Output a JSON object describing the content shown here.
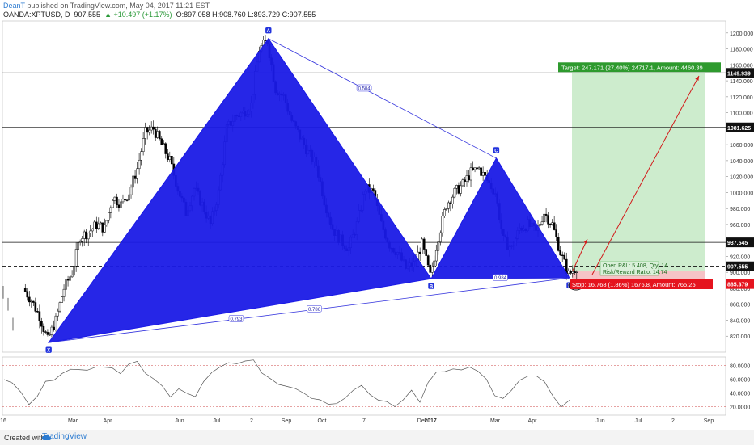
{
  "header": {
    "author": "DeanT",
    "published": " published on TradingView.com, May 04, 2017 11:21 EST",
    "symbol": "OANDA:XPTUSD, D",
    "last": "907.555",
    "change": "▲ +10.497 (+1.17%)",
    "ohlc": "O:897.058 H:908.760 L:893.729 C:907.555"
  },
  "footer": {
    "made_with": "Created with",
    "brand": "TradingView"
  },
  "colors": {
    "pattern_fill": "#1a1ae6",
    "target_zone": "#cdeccd",
    "stop_zone": "#f6c3c6",
    "target_label": "#2e9a2e",
    "stop_label": "#e5141e",
    "arrow": "#d21a1a",
    "rsi_line": "#555555"
  },
  "chart_data": {
    "type": "candlestick",
    "symbol": "XPTUSD",
    "timeframe": "D",
    "ylim": [
      800,
      1215
    ],
    "y_ticks": [
      "1200.000",
      "1180.000",
      "1160.000",
      "1140.000",
      "1120.000",
      "1100.000",
      "1080.000",
      "1060.000",
      "1040.000",
      "1020.000",
      "1000.000",
      "980.000",
      "960.000",
      "940.000",
      "920.000",
      "900.000",
      "880.000",
      "860.000",
      "840.000",
      "820.000",
      "800.000"
    ],
    "x_labels": [
      "16",
      "Mar",
      "Apr",
      "Jun",
      "Jul",
      "2",
      "Sep",
      "Oct",
      "7",
      "Dec",
      "2017",
      "Mar",
      "Apr",
      "Jun",
      "Jul",
      "2",
      "Sep"
    ],
    "price_path": [
      [
        0,
        880
      ],
      [
        1,
        865
      ],
      [
        2,
        845
      ],
      [
        3,
        815
      ],
      [
        4,
        840
      ],
      [
        5,
        880
      ],
      [
        6,
        900
      ],
      [
        7,
        945
      ],
      [
        8,
        950
      ],
      [
        9,
        960
      ],
      [
        10,
        955
      ],
      [
        11,
        995
      ],
      [
        12,
        985
      ],
      [
        13,
        1000
      ],
      [
        14,
        1030
      ],
      [
        15,
        1075
      ],
      [
        16,
        1080
      ],
      [
        17,
        1060
      ],
      [
        18,
        1040
      ],
      [
        19,
        1005
      ],
      [
        20,
        975
      ],
      [
        21,
        1005
      ],
      [
        22,
        985
      ],
      [
        23,
        960
      ],
      [
        24,
        1000
      ],
      [
        25,
        1080
      ],
      [
        26,
        1095
      ],
      [
        27,
        1100
      ],
      [
        28,
        1110
      ],
      [
        29,
        1180
      ],
      [
        30,
        1190
      ],
      [
        31,
        1130
      ],
      [
        32,
        1120
      ],
      [
        33,
        1090
      ],
      [
        34,
        1070
      ],
      [
        35,
        1050
      ],
      [
        36,
        1035
      ],
      [
        37,
        990
      ],
      [
        38,
        955
      ],
      [
        39,
        940
      ],
      [
        40,
        930
      ],
      [
        41,
        960
      ],
      [
        42,
        1005
      ],
      [
        43,
        1000
      ],
      [
        44,
        960
      ],
      [
        45,
        935
      ],
      [
        46,
        925
      ],
      [
        47,
        905
      ],
      [
        48,
        910
      ],
      [
        49,
        935
      ],
      [
        50,
        895
      ],
      [
        51,
        945
      ],
      [
        52,
        985
      ],
      [
        53,
        1000
      ],
      [
        54,
        1010
      ],
      [
        55,
        1025
      ],
      [
        56,
        1030
      ],
      [
        57,
        1015
      ],
      [
        58,
        1000
      ],
      [
        59,
        940
      ],
      [
        60,
        930
      ],
      [
        61,
        955
      ],
      [
        62,
        960
      ],
      [
        63,
        950
      ],
      [
        64,
        975
      ],
      [
        65,
        960
      ],
      [
        66,
        925
      ],
      [
        67,
        897
      ],
      [
        68,
        907
      ]
    ],
    "horizontal_levels": [
      {
        "label": "1149.939",
        "value": 1149.939,
        "color": "#000000"
      },
      {
        "label": "1081.625",
        "value": 1081.625,
        "color": "#000000"
      },
      {
        "label": "937.545",
        "value": 937.545,
        "color": "#000000"
      },
      {
        "label": "907.555",
        "value": 907.555,
        "color": "#000000"
      },
      {
        "label": "885.379",
        "value": 885.379,
        "color": "#e5141e"
      }
    ],
    "pattern_points": [
      {
        "label": "X",
        "x": 3,
        "y": 812
      },
      {
        "label": "A",
        "x": 30,
        "y": 1193
      },
      {
        "label": "B",
        "x": 50,
        "y": 892
      },
      {
        "label": "C",
        "x": 58,
        "y": 1043
      },
      {
        "label": "D",
        "x": 67,
        "y": 893
      }
    ],
    "ratios": [
      "0.504",
      "0.984",
      "0.793",
      "0.786"
    ],
    "position": {
      "target_text": "Target: 247.171 (27.40%) 24717.1, Amount: 4460.39",
      "open_pl_text": "Open P&L: 5.408, Qty: 14",
      "risk_reward_text": "Risk/Reward Ratio: 14.74",
      "stop_text": "Stop: 16.768 (1.86%) 1676.8, Amount: 765.25",
      "entry": 902,
      "target": 1149.939,
      "stop": 885.379
    },
    "rsi": {
      "ylim": [
        10,
        90
      ],
      "y_ticks": [
        "80.0000",
        "60.0000",
        "40.0000",
        "20.0000"
      ],
      "overbought": 80,
      "oversold": 20,
      "values": [
        62,
        55,
        40,
        25,
        35,
        55,
        60,
        68,
        72,
        75,
        72,
        80,
        78,
        75,
        70,
        82,
        84,
        70,
        60,
        48,
        35,
        45,
        42,
        35,
        55,
        72,
        78,
        82,
        84,
        86,
        88,
        70,
        60,
        55,
        50,
        45,
        42,
        32,
        28,
        25,
        24,
        30,
        45,
        50,
        40,
        30,
        26,
        22,
        30,
        42,
        28,
        55,
        68,
        72,
        74,
        76,
        78,
        70,
        62,
        36,
        30,
        45,
        58,
        62,
        66,
        55,
        38,
        20,
        28
      ]
    }
  }
}
